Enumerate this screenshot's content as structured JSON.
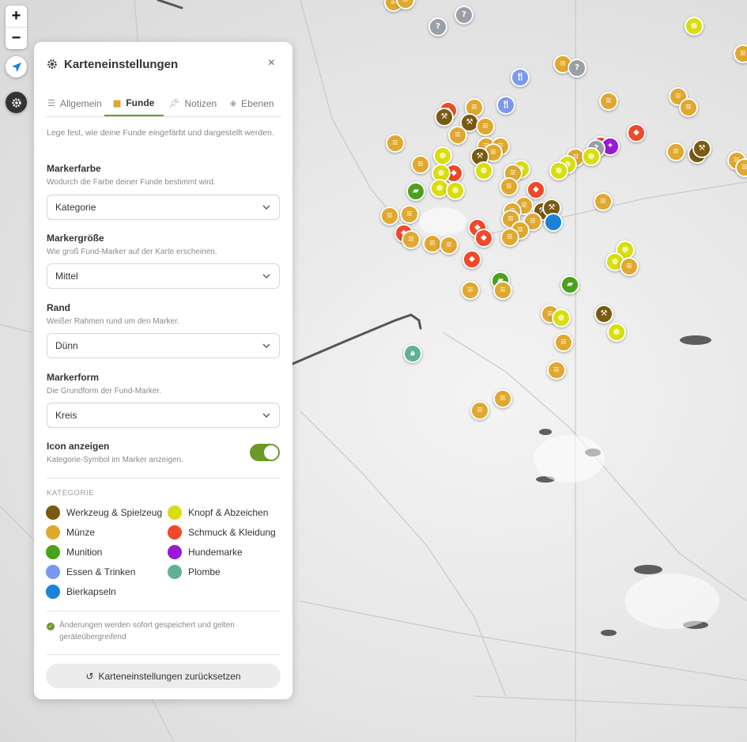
{
  "map_controls": {
    "zoom_in": "+",
    "zoom_out": "−"
  },
  "panel": {
    "title": "Karteneinstellungen",
    "close": "×",
    "tabs": [
      {
        "label": "Allgemein",
        "icon": "sliders-icon",
        "active": false
      },
      {
        "label": "Funde",
        "icon": "grid-icon",
        "active": true
      },
      {
        "label": "Notizen",
        "icon": "pin-icon",
        "active": false
      },
      {
        "label": "Ebenen",
        "icon": "layers-icon",
        "active": false
      }
    ],
    "intro": "Lege fest, wie deine Funde eingefärbt und dargestellt werden.",
    "marker_color": {
      "label": "Markerfarbe",
      "desc": "Wodurch die Farbe deiner Funde bestimmt wird.",
      "value": "Kategorie"
    },
    "marker_size": {
      "label": "Markergröße",
      "desc": "Wie groß Fund-Marker auf der Karte erscheinen.",
      "value": "Mittel"
    },
    "border": {
      "label": "Rand",
      "desc": "Weißer Rahmen rund um den Marker.",
      "value": "Dünn"
    },
    "shape": {
      "label": "Markerform",
      "desc": "Die Grundform der Fund-Marker.",
      "value": "Kreis"
    },
    "show_icon": {
      "label": "Icon anzeigen",
      "desc": "Kategorie-Symbol im Marker anzeigen.",
      "enabled": true
    },
    "category_heading": "KATEGORIE",
    "categories": [
      {
        "label": "Werkzeug & Spielzeug",
        "color": "#7a5a10"
      },
      {
        "label": "Knopf & Abzeichen",
        "color": "#d9dd10"
      },
      {
        "label": "Münze",
        "color": "#e0a830"
      },
      {
        "label": "Schmuck & Kleidung",
        "color": "#ee4a2a"
      },
      {
        "label": "Munition",
        "color": "#4aa21c"
      },
      {
        "label": "Hundemarke",
        "color": "#9a18d8"
      },
      {
        "label": "Essen & Trinken",
        "color": "#7a98ee"
      },
      {
        "label": "Plombe",
        "color": "#62b09a"
      },
      {
        "label": "Bierkapseln",
        "color": "#1a82d8"
      }
    ],
    "note": "Änderungen werden sofort gespeichert und gelten geräteübergreifend",
    "reset_label": "Karteneinstellungen zurücksetzen"
  },
  "colors": {
    "accent_green": "#6a9a2a",
    "unknown_gray": "#9aa0a8"
  }
}
